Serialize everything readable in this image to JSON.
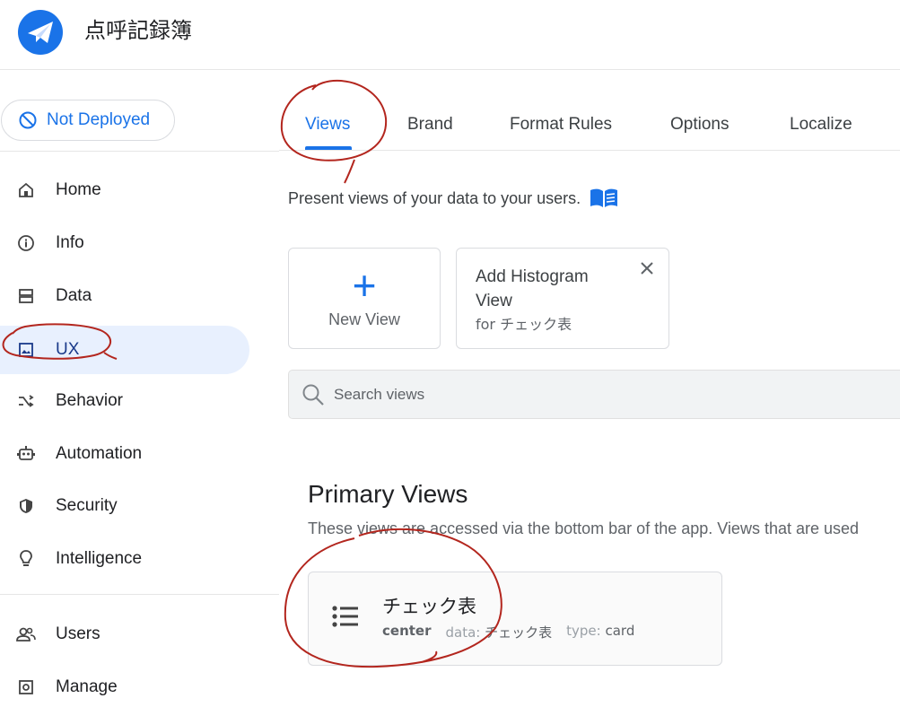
{
  "app": {
    "title": "点呼記録簿",
    "logo_icon": "paper-plane-icon",
    "brand_color": "#1a73e8"
  },
  "deploy_status": {
    "label": "Not Deployed",
    "icon": "not-deployed-icon"
  },
  "sidebar": {
    "items": [
      {
        "label": "Home",
        "icon": "home-icon",
        "active": false
      },
      {
        "label": "Info",
        "icon": "info-icon",
        "active": false
      },
      {
        "label": "Data",
        "icon": "data-icon",
        "active": false
      },
      {
        "label": "UX",
        "icon": "ux-icon",
        "active": true
      },
      {
        "label": "Behavior",
        "icon": "behavior-icon",
        "active": false
      },
      {
        "label": "Automation",
        "icon": "automation-icon",
        "active": false
      },
      {
        "label": "Security",
        "icon": "security-icon",
        "active": false
      },
      {
        "label": "Intelligence",
        "icon": "intelligence-icon",
        "active": false
      },
      {
        "label": "Users",
        "icon": "users-icon",
        "active": false
      },
      {
        "label": "Manage",
        "icon": "manage-icon",
        "active": false
      }
    ]
  },
  "tabs": [
    {
      "label": "Views",
      "active": true
    },
    {
      "label": "Brand",
      "active": false
    },
    {
      "label": "Format Rules",
      "active": false
    },
    {
      "label": "Options",
      "active": false
    },
    {
      "label": "Localize",
      "active": false
    }
  ],
  "description": "Present views of your data to your users.",
  "new_view": {
    "label": "New View"
  },
  "suggestion": {
    "title": "Add Histogram View",
    "subtitle": "for チェック表"
  },
  "search": {
    "placeholder": "Search views",
    "value": ""
  },
  "primary_views": {
    "title": "Primary Views",
    "description": "These views are accessed via the bottom bar of the app. Views that are used",
    "views": [
      {
        "name": "チェック表",
        "position": "center",
        "data_label": "data:",
        "data_value": "チェック表",
        "type_label": "type:",
        "type_value": "card",
        "icon": "list-icon"
      }
    ]
  },
  "annotation_color": "#b3261e"
}
